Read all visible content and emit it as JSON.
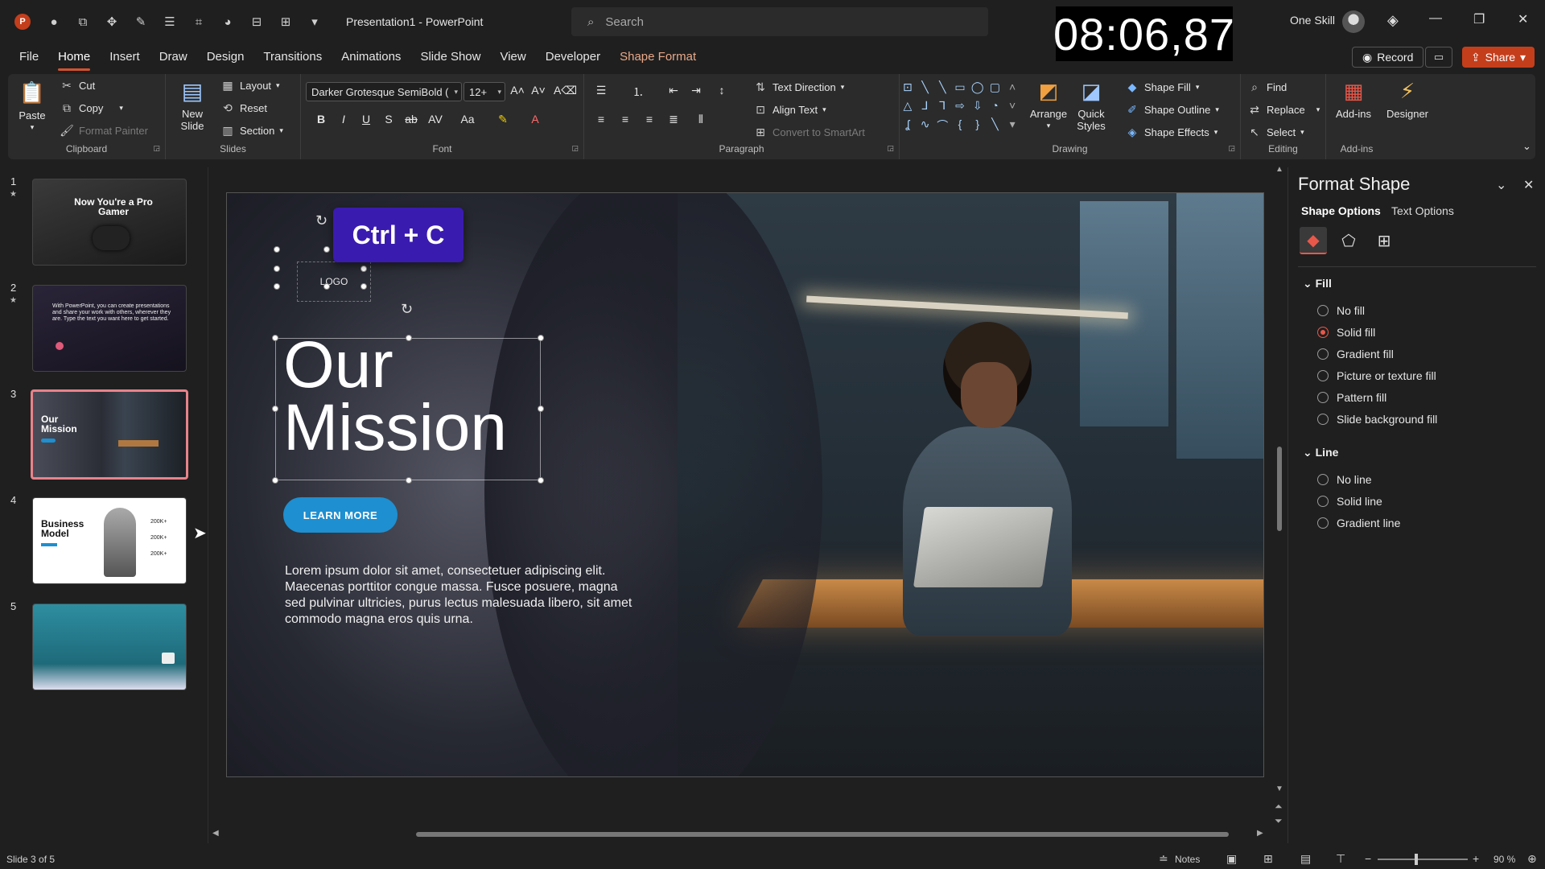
{
  "window": {
    "title": "Presentation1  -  PowerPoint",
    "search_placeholder": "Search",
    "timer": "08:06,87",
    "user_name": "One Skill"
  },
  "tabs": [
    {
      "label": "File"
    },
    {
      "label": "Home"
    },
    {
      "label": "Insert"
    },
    {
      "label": "Draw"
    },
    {
      "label": "Design"
    },
    {
      "label": "Transitions"
    },
    {
      "label": "Animations"
    },
    {
      "label": "Slide Show"
    },
    {
      "label": "View"
    },
    {
      "label": "Developer"
    },
    {
      "label": "Shape Format"
    }
  ],
  "topbuttons": {
    "record": "Record",
    "share": "Share"
  },
  "ribbon": {
    "clipboard": {
      "label": "Clipboard",
      "paste": "Paste",
      "cut": "Cut",
      "copy": "Copy",
      "format_painter": "Format Painter"
    },
    "slides": {
      "label": "Slides",
      "new_slide_1": "New",
      "new_slide_2": "Slide",
      "layout": "Layout",
      "reset": "Reset",
      "section": "Section"
    },
    "font": {
      "label": "Font",
      "font_name": "Darker Grotesque SemiBold (",
      "font_size": "12+"
    },
    "paragraph": {
      "label": "Paragraph",
      "text_direction": "Text Direction",
      "align_text": "Align Text",
      "convert_smartart": "Convert to SmartArt"
    },
    "drawing": {
      "label": "Drawing",
      "arrange": "Arrange",
      "quick_styles_1": "Quick",
      "quick_styles_2": "Styles",
      "shape_fill": "Shape Fill",
      "shape_outline": "Shape Outline",
      "shape_effects": "Shape Effects"
    },
    "editing": {
      "label": "Editing",
      "find": "Find",
      "replace": "Replace",
      "select": "Select"
    },
    "addins": {
      "label": "Add-ins",
      "addins_btn": "Add-ins",
      "designer": "Designer"
    }
  },
  "thumbnails": [
    {
      "num": "1",
      "title": "Now You're a Pro Gamer"
    },
    {
      "num": "2",
      "title": "With PowerPoint, you can create presentations and share your work with others, wherever they are. Type the text you want here to get started."
    },
    {
      "num": "3",
      "title": "Our Mission"
    },
    {
      "num": "4",
      "title": "Business Model",
      "values": [
        "200K+",
        "200K+",
        "200K+"
      ]
    },
    {
      "num": "5",
      "title": ""
    }
  ],
  "slide": {
    "logo": "LOGO",
    "title_line1": "Our",
    "title_line2": "Mission",
    "button": "LEARN MORE",
    "body": "Lorem ipsum dolor sit amet, consectetuer adipiscing elit. Maecenas porttitor congue massa. Fusce posuere, magna sed pulvinar ultricies, purus lectus malesuada libero, sit amet commodo magna eros quis urna."
  },
  "shortcut_overlay": "Ctrl + C",
  "format_pane": {
    "title": "Format Shape",
    "tab_shape": "Shape Options",
    "tab_text": "Text Options",
    "fill_section": "Fill",
    "fill_options": [
      "No fill",
      "Solid fill",
      "Gradient fill",
      "Picture or texture fill",
      "Pattern fill",
      "Slide background fill"
    ],
    "fill_selected": "Solid fill",
    "line_section": "Line",
    "line_options": [
      "No line",
      "Solid line",
      "Gradient line"
    ]
  },
  "status": {
    "slide_info": "Slide 3 of 5",
    "notes": "Notes",
    "zoom": "90 %",
    "zoom_level": 0.43
  },
  "colors": {
    "accent": "#d35230",
    "share": "#c43e1c",
    "overlay": "#3a1bb0",
    "slide_button": "#1e8fd0",
    "selected_thumb": "#e8828a"
  }
}
